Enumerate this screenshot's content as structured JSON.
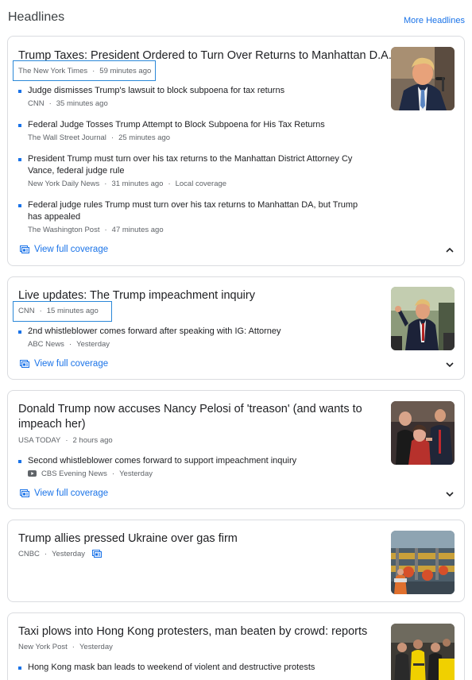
{
  "header": {
    "title": "Headlines",
    "more_link": "More Headlines"
  },
  "stories": [
    {
      "headline": "Trump Taxes: President Ordered to Turn Over Returns to Manhattan D.A.",
      "source": "The New York Times",
      "time": "59 minutes ago",
      "subs": [
        {
          "title": "Judge dismisses Trump's lawsuit to block subpoena for tax returns",
          "source": "CNN",
          "time": "35 minutes ago"
        },
        {
          "title": "Federal Judge Tosses Trump Attempt to Block Subpoena for His Tax Returns",
          "source": "The Wall Street Journal",
          "time": "25 minutes ago"
        },
        {
          "title": "President Trump must turn over his tax returns to the Manhattan District Attorney Cy Vance, federal judge rule",
          "source": "New York Daily News",
          "time": "31 minutes ago",
          "tag": "Local coverage"
        },
        {
          "title": "Federal judge rules Trump must turn over his tax returns to Manhattan DA, but Trump has appealed",
          "source": "The Washington Post",
          "time": "47 minutes ago"
        }
      ],
      "coverage": "View full coverage",
      "expanded": true
    },
    {
      "headline": "Live updates: The Trump impeachment inquiry",
      "source": "CNN",
      "time": "15 minutes ago",
      "subs": [
        {
          "title": "2nd whistleblower comes forward after speaking with IG: Attorney",
          "source": "ABC News",
          "time": "Yesterday"
        }
      ],
      "coverage": "View full coverage",
      "expanded": false
    },
    {
      "headline": "Donald Trump now accuses Nancy Pelosi of 'treason' (and wants to impeach her)",
      "source": "USA TODAY",
      "time": "2 hours ago",
      "subs": [
        {
          "title": "Second whistleblower comes forward to support impeachment inquiry",
          "source": "CBS Evening News",
          "time": "Yesterday",
          "video": true
        }
      ],
      "coverage": "View full coverage",
      "expanded": false
    },
    {
      "headline": "Trump allies pressed Ukraine over gas firm",
      "source": "CNBC",
      "time": "Yesterday"
    },
    {
      "headline": "Taxi plows into Hong Kong protesters, man beaten by crowd: reports",
      "source": "New York Post",
      "time": "Yesterday",
      "subs": [
        {
          "title": "Hong Kong mask ban leads to weekend of violent and destructive protests"
        }
      ]
    }
  ],
  "colors": {
    "link": "#1a73e8",
    "text": "#202124",
    "meta": "#5f6368",
    "highlight": "#2b88d8",
    "border": "#dadce0"
  }
}
